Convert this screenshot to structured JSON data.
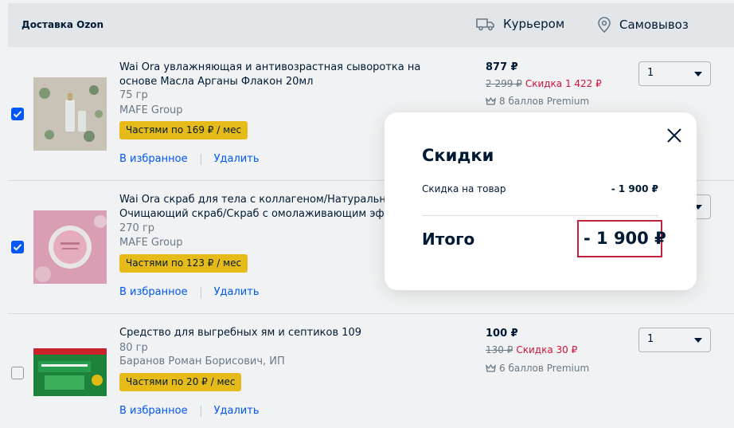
{
  "header": {
    "title": "Доставка Ozon",
    "courier_label": "Курьером",
    "pickup_label": "Самовывоз"
  },
  "items": [
    {
      "checked": true,
      "name": "Wai Ora увлажняющая и антивозрастная сыворотка на основе Масла Арганы Флакон 20мл",
      "weight": "75 гр",
      "seller": "MAFE Group",
      "installment": "Частями по 169 ₽ / мес",
      "favorite_label": "В избранное",
      "delete_label": "Удалить",
      "price": "877 ₽",
      "old_price": "2 299 ₽",
      "discount": "Скидка 1 422 ₽",
      "bonus": "8 баллов Premium",
      "quantity": "1"
    },
    {
      "checked": true,
      "name": "Wai Ora скраб для тела с коллагеном/Натуральный Очищающий скраб/Скраб с омолаживающим эффе",
      "weight": "270 гр",
      "seller": "MAFE Group",
      "installment": "Частями по 123 ₽ / мес",
      "favorite_label": "В избранное",
      "delete_label": "Удалить"
    },
    {
      "checked": false,
      "name": "Средство для выгребных ям и септиков 109",
      "weight": "80 гр",
      "seller": "Баранов Роман Борисович, ИП",
      "installment": "Частями по 20 ₽ / мес",
      "favorite_label": "В избранное",
      "delete_label": "Удалить",
      "price": "100 ₽",
      "old_price": "130 ₽",
      "discount": "Скидка 30 ₽",
      "bonus": "6 баллов Premium",
      "quantity": "1"
    }
  ],
  "modal": {
    "title": "Скидки",
    "row_label": "Скидка на товар",
    "row_value": "- 1 900 ₽",
    "total_label": "Итого",
    "total_value": "- 1 900 ₽"
  },
  "colors": {
    "brand_blue": "#005bff",
    "discount_red": "#e0123c",
    "installment_yellow": "#f5c518",
    "highlight_border": "#c0223b"
  }
}
